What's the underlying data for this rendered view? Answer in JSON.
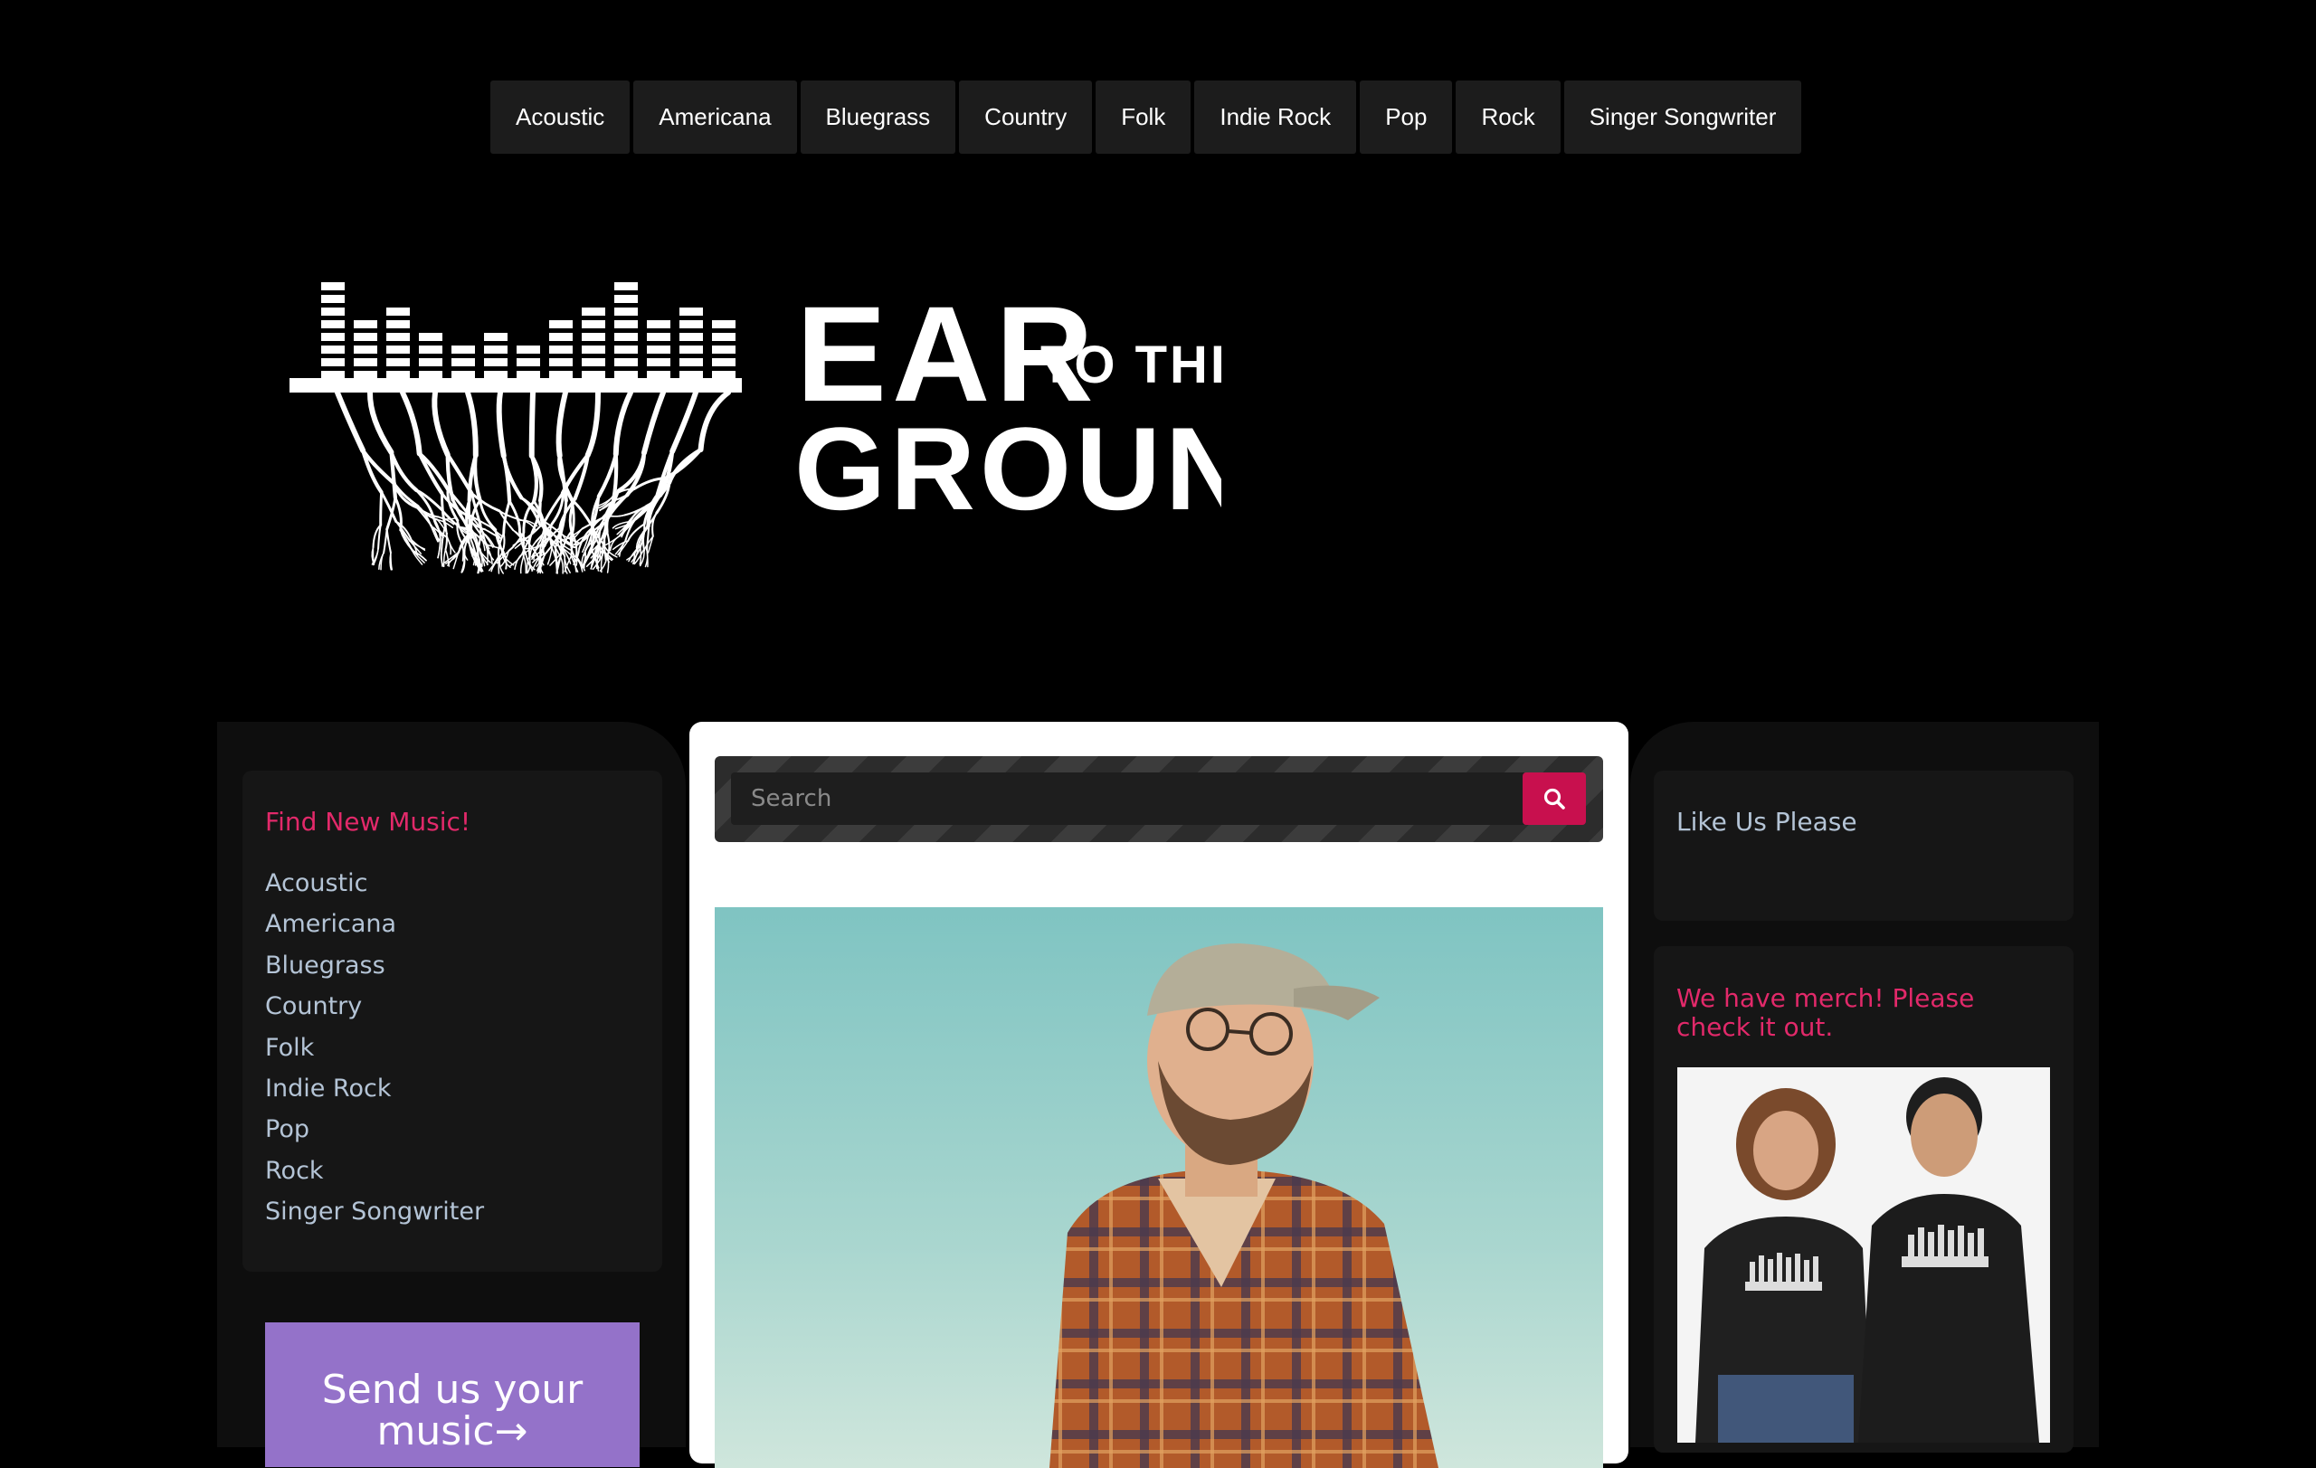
{
  "top_nav": {
    "items": [
      "Acoustic",
      "Americana",
      "Bluegrass",
      "Country",
      "Folk",
      "Indie Rock",
      "Pop",
      "Rock",
      "Singer Songwriter"
    ]
  },
  "logo": {
    "line1": "EAR",
    "line1_small": "TO THE",
    "line2": "GROUND"
  },
  "left_sidebar": {
    "find_music_title": "Find New Music!",
    "genres": [
      "Acoustic",
      "Americana",
      "Bluegrass",
      "Country",
      "Folk",
      "Indie Rock",
      "Pop",
      "Rock",
      "Singer Songwriter"
    ],
    "send_music_label": "Send us your music→"
  },
  "search": {
    "placeholder": "Search",
    "icon": "search-icon"
  },
  "right_sidebar": {
    "like_title": "Like Us Please",
    "merch_title": "We have merch! Please check it out."
  },
  "colors": {
    "accent_pink": "#e2296a",
    "search_button": "#c8104e",
    "send_button": "#9472c9",
    "link_blue": "#b4c4d6"
  }
}
